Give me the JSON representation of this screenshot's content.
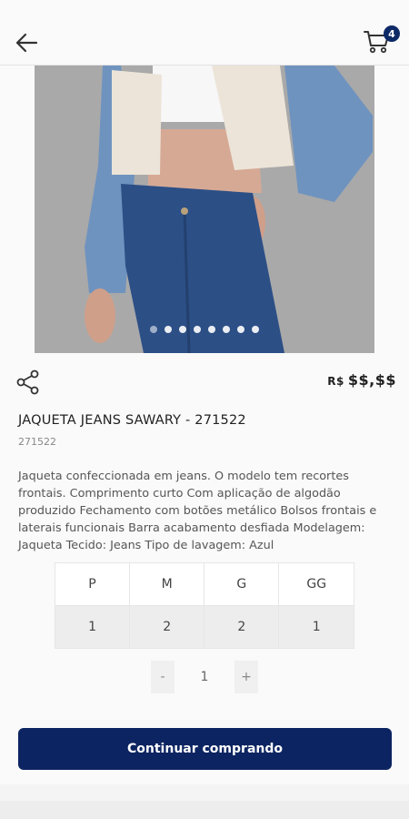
{
  "header": {
    "back_icon": "arrow-left-icon",
    "cart_icon": "shopping-cart-icon",
    "cart_count": "4"
  },
  "product": {
    "image_alt": "woman wearing denim jacket with white fleece panels and high-waisted blue jeans",
    "carousel_dot_count": 8,
    "carousel_active_index": 0,
    "price_currency": "R$",
    "price_value": "$$,$$",
    "title": "JAQUETA JEANS SAWARY - 271522",
    "sku": "271522",
    "description": "Jaqueta confeccionada em jeans. O modelo tem recortes frontais. Comprimento curto Com aplicação de algodão produzido Fechamento com botões metálico Bolsos frontais e laterais funcionais Barra acabamento desfiada Modelagem: Jaqueta Tecido: Jeans Tipo de lavagem: Azul"
  },
  "sizes": {
    "labels": [
      "P",
      "M",
      "G",
      "GG"
    ],
    "stock": [
      "1",
      "2",
      "2",
      "1"
    ]
  },
  "quantity": {
    "minus": "-",
    "value": "1",
    "plus": "+"
  },
  "actions": {
    "continue_label": "Continuar comprando"
  },
  "colors": {
    "primary": "#0c2461",
    "badge": "#0d2966"
  }
}
